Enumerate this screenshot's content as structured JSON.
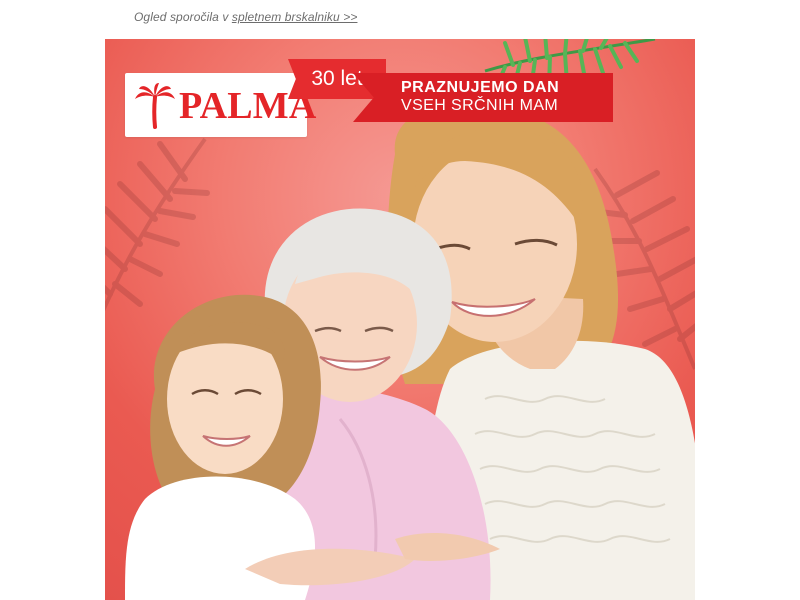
{
  "preheader": {
    "prefix": "Ogled sporočila v",
    "link": "spletnem brskalniku >>"
  },
  "banner": {
    "brand": "PALMA",
    "anniversary": "30 let",
    "headline_line1": "PRAZNUJEMO DAN",
    "headline_line2": "VSEH SRČNIH MAM",
    "background_color": "#ef6e66",
    "accent_color": "#e42528"
  }
}
